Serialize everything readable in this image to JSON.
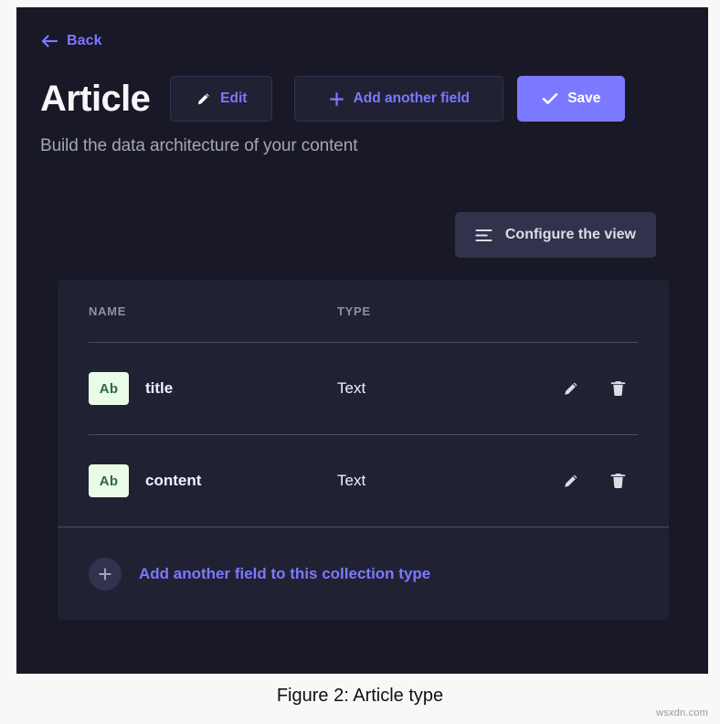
{
  "app": {
    "back_link": {
      "label": "Back",
      "icon": "arrow-left-icon"
    },
    "title": "Article",
    "subtitle": "Build the data architecture of your content",
    "header_buttons": [
      {
        "id": "edit",
        "label": "Edit",
        "icon": "pencil-icon",
        "style": "ghost"
      },
      {
        "id": "add-another-field",
        "label": "Add another field",
        "icon": "plus-icon",
        "style": "ghost"
      },
      {
        "id": "save",
        "label": "Save",
        "icon": "check-icon",
        "style": "primary"
      }
    ],
    "configure_view": {
      "label": "Configure the view",
      "icon": "list-lines-icon"
    }
  },
  "fields_table": {
    "columns": [
      {
        "key": "name",
        "label": "NAME"
      },
      {
        "key": "type",
        "label": "TYPE"
      }
    ],
    "rows": [
      {
        "badge": "Ab",
        "name": "title",
        "type": "Text",
        "actions": [
          {
            "id": "edit",
            "icon": "pencil-icon"
          },
          {
            "id": "delete",
            "icon": "trash-icon"
          }
        ]
      },
      {
        "badge": "Ab",
        "name": "content",
        "type": "Text",
        "actions": [
          {
            "id": "edit",
            "icon": "pencil-icon"
          },
          {
            "id": "delete",
            "icon": "trash-icon"
          }
        ]
      }
    ],
    "footer": {
      "label": "Add another field to this collection type",
      "icon": "plus-icon"
    }
  },
  "figure": {
    "caption": "Figure 2: Article type",
    "watermark": "wsxdn.com"
  },
  "colors": {
    "app_background": "#181826",
    "card_background": "#212134",
    "accent": "#7b79ff",
    "muted_text": "#a5a5ba",
    "badge_background": "#eafbe7",
    "badge_text": "#2f6846",
    "divider": "#4a4a6a"
  }
}
